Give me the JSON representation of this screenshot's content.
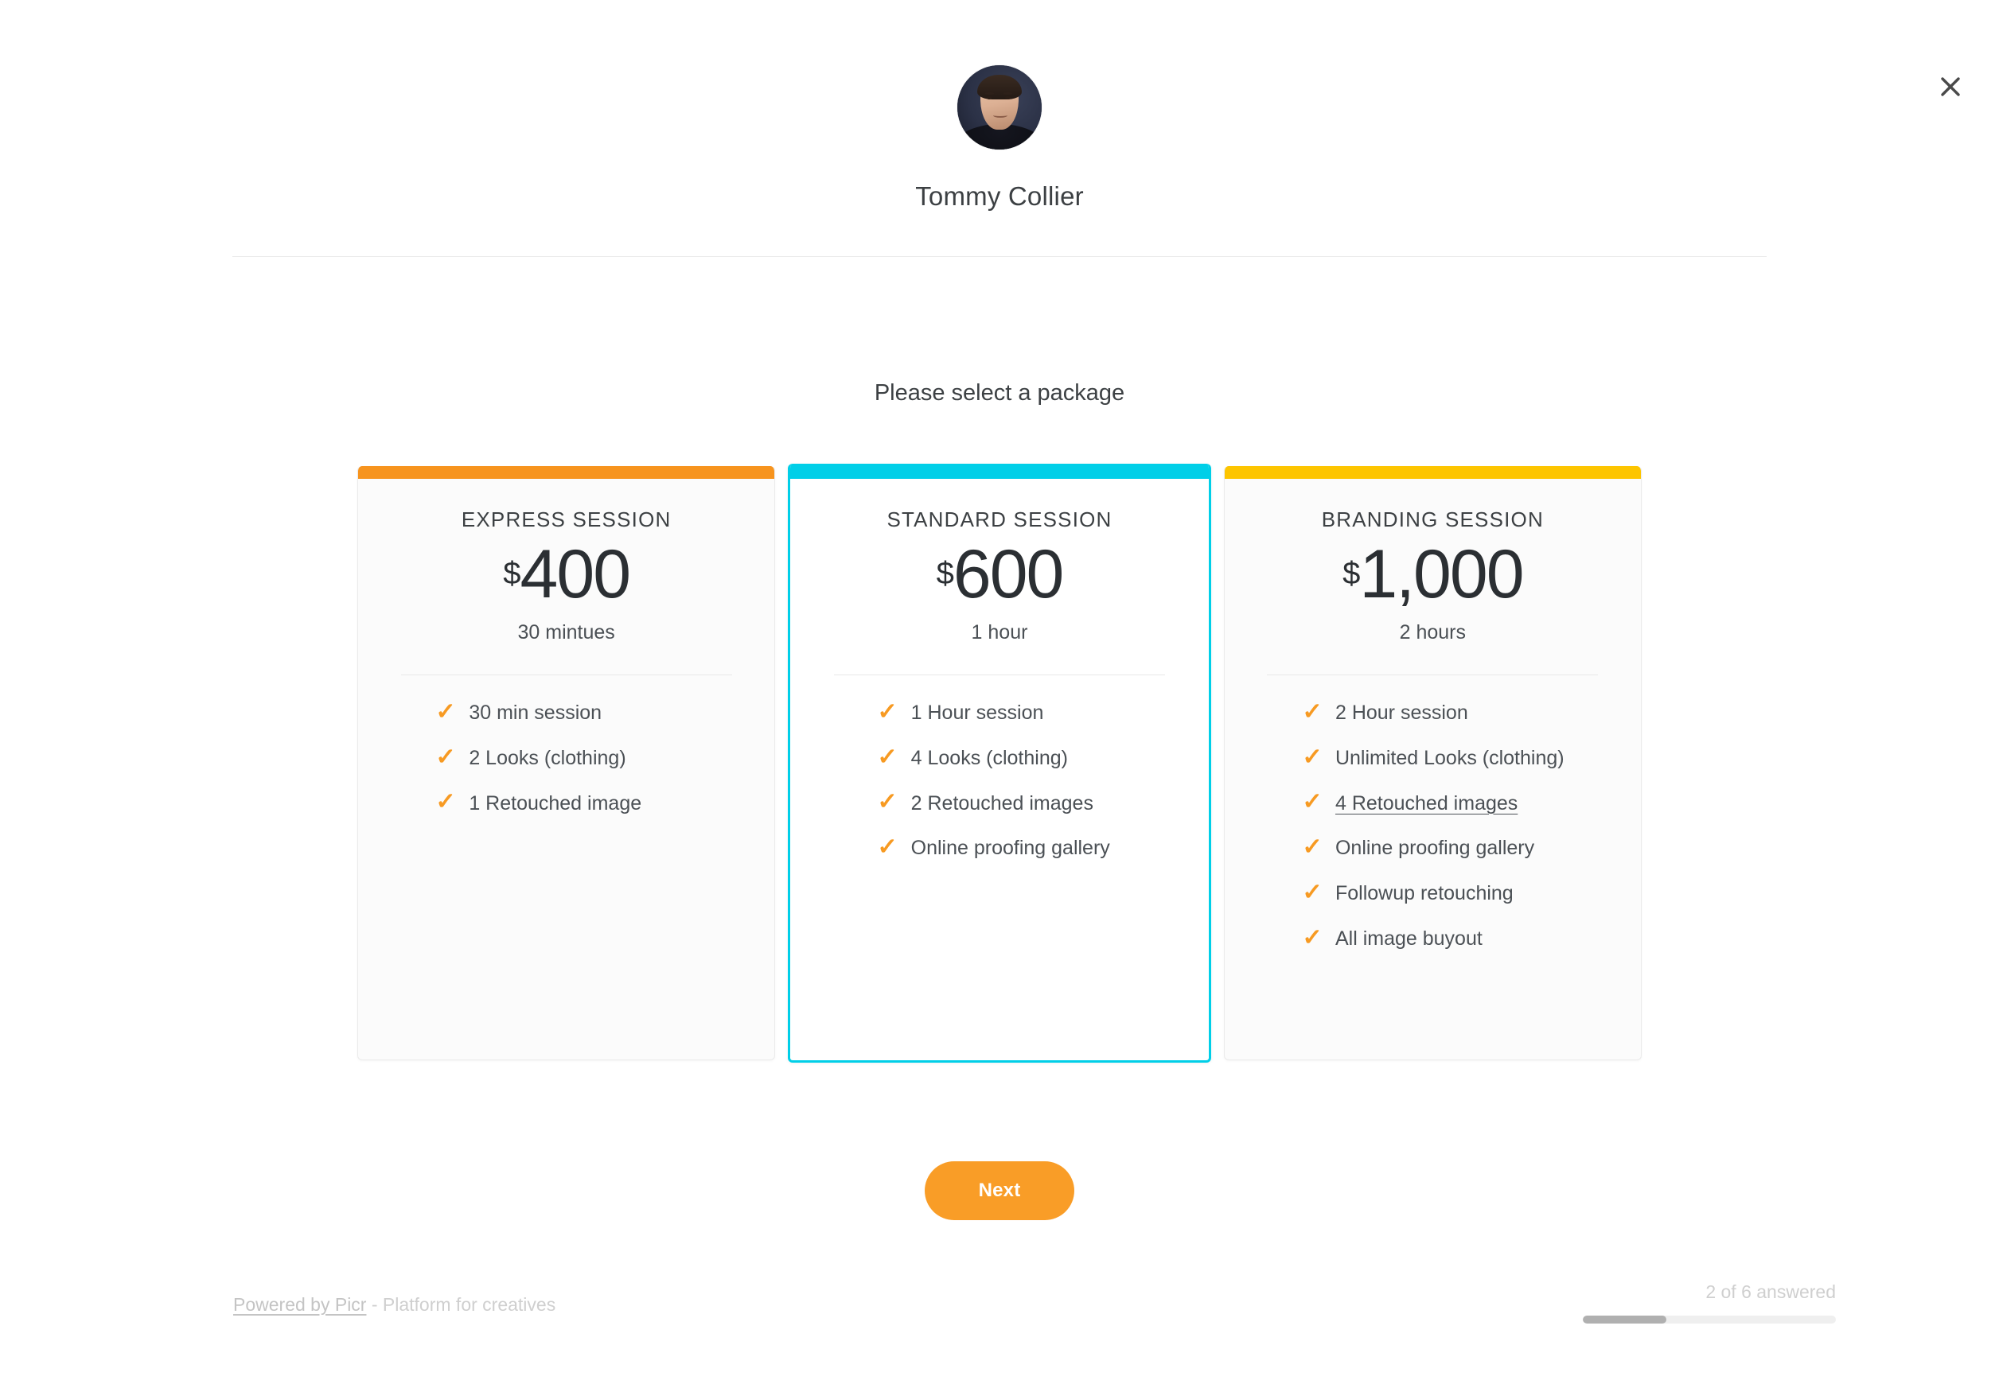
{
  "window": {
    "close_icon": "close-icon"
  },
  "header": {
    "avatar_alt": "Tommy Collier profile photo",
    "profile_name": "Tommy Collier"
  },
  "main": {
    "prompt": "Please select a package"
  },
  "packages": [
    {
      "id": "express",
      "title": "EXPRESS SESSION",
      "currency": "$",
      "amount": "400",
      "duration": "30 mintues",
      "accent_color": "#f7941e",
      "selected": false,
      "features": [
        {
          "label": "30 min session",
          "highlighted": false
        },
        {
          "label": "2 Looks (clothing)",
          "highlighted": false
        },
        {
          "label": "1 Retouched image",
          "highlighted": false
        }
      ]
    },
    {
      "id": "standard",
      "title": "STANDARD SESSION",
      "currency": "$",
      "amount": "600",
      "duration": "1 hour",
      "accent_color": "#00cfe8",
      "selected": true,
      "features": [
        {
          "label": "1 Hour session",
          "highlighted": false
        },
        {
          "label": "4 Looks (clothing)",
          "highlighted": false
        },
        {
          "label": "2 Retouched images",
          "highlighted": false
        },
        {
          "label": "Online proofing gallery",
          "highlighted": false
        }
      ]
    },
    {
      "id": "branding",
      "title": "BRANDING SESSION",
      "currency": "$",
      "amount": "1,000",
      "duration": "2 hours",
      "accent_color": "#fdc500",
      "selected": false,
      "features": [
        {
          "label": "2 Hour session",
          "highlighted": false
        },
        {
          "label": "Unlimited Looks (clothing)",
          "highlighted": false
        },
        {
          "label": "4 Retouched images",
          "highlighted": true
        },
        {
          "label": "Online proofing gallery",
          "highlighted": false
        },
        {
          "label": "Followup retouching",
          "highlighted": false
        },
        {
          "label": "All image buyout",
          "highlighted": false
        }
      ]
    }
  ],
  "actions": {
    "next_label": "Next",
    "next_color": "#f99d27"
  },
  "footer": {
    "powered_by_link": "Powered by Picr",
    "tagline": " - Platform for creatives",
    "progress_label": "2 of 6 answered",
    "progress_answered": 2,
    "progress_total": 6,
    "progress_percent": 33
  },
  "icons": {
    "check": "✓"
  }
}
